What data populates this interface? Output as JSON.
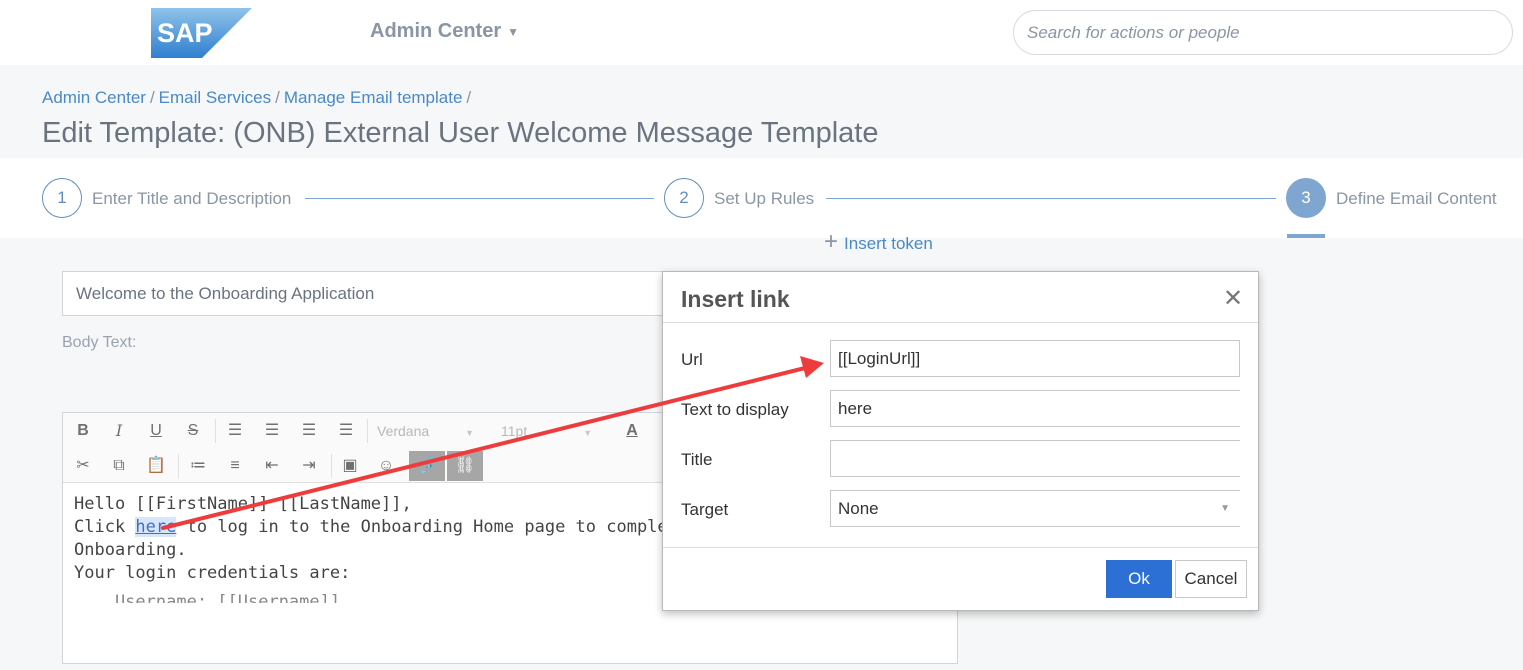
{
  "header": {
    "logo_text": "SAP",
    "admin_center_label": "Admin Center",
    "search_placeholder": "Search for actions or people"
  },
  "breadcrumb": {
    "items": [
      "Admin Center",
      "Email Services",
      "Manage Email template"
    ],
    "separator": "/"
  },
  "page_title": "Edit Template: (ONB) External User Welcome Message Template",
  "stepper": {
    "steps": [
      {
        "number": "1",
        "label": "Enter Title and Description",
        "active": false
      },
      {
        "number": "2",
        "label": "Set Up Rules",
        "active": false
      },
      {
        "number": "3",
        "label": "Define Email Content",
        "active": true
      }
    ]
  },
  "content": {
    "insert_token_label": "Insert token",
    "subject_value": "Welcome to the Onboarding Application",
    "body_label": "Body Text:",
    "toolbar": {
      "font_family": "Verdana",
      "font_size": "11pt",
      "text_color_glyph": "A"
    },
    "body_lines": {
      "line1": "Hello [[FirstName]] [[LastName]],",
      "line2_pre": "Click ",
      "line2_link": "here",
      "line2_post": " to log in to the Onboarding Home page to complete the",
      "line3": "Onboarding.",
      "line4": "Your login credentials are:",
      "line5": "    Username: [[Username]]"
    }
  },
  "dialog": {
    "title": "Insert link",
    "close_glyph": "✕",
    "url_label": "Url",
    "url_value": "[[LoginUrl]]",
    "text_label": "Text to display",
    "text_value": "here",
    "title_label": "Title",
    "title_value": "",
    "target_label": "Target",
    "target_value": "None",
    "ok_label": "Ok",
    "cancel_label": "Cancel"
  },
  "colors": {
    "accent_blue": "#2c6fd5",
    "link_blue": "#4a89c6",
    "stepper_active": "#7ea6d0",
    "arrow_red": "#ee3c3c"
  }
}
